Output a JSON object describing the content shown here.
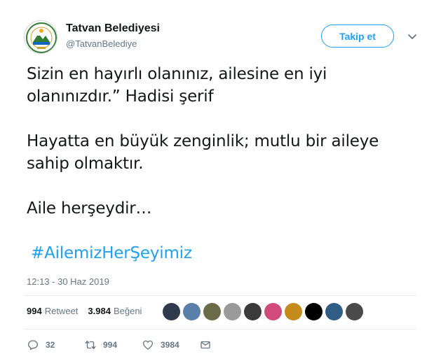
{
  "account": {
    "name": "Tatvan Belediyesi",
    "handle": "@TatvanBelediye",
    "avatar_icon": "municipality-logo-icon"
  },
  "follow_button": {
    "label": "Takip et"
  },
  "menu": {
    "icon": "chevron-down-icon"
  },
  "tweet": {
    "text": "Sizin en hayırlı olanınız, ailesine en iyi\nolanınızdır.” Hadisi şerif\n\nHayatta en büyük zenginlik; mutlu bir aileye\nsahip olmaktır.\n\nAile herşeydir…",
    "hashtag": "#AilemizHerŞeyimiz",
    "timestamp": "12:13 - 30 Haz 2019"
  },
  "stats": {
    "retweets_count": "994",
    "retweets_label": "Retweet",
    "likes_count": "3.984",
    "likes_label": "Beğeni"
  },
  "likers": [
    {
      "name": "liker-avatar-1",
      "color": "#2f3b4c"
    },
    {
      "name": "liker-avatar-2",
      "color": "#5a7fa8"
    },
    {
      "name": "liker-avatar-3",
      "color": "#6b6b4a"
    },
    {
      "name": "liker-avatar-4",
      "color": "#9a9a9a"
    },
    {
      "name": "liker-avatar-5",
      "color": "#3a3a3a"
    },
    {
      "name": "liker-avatar-6",
      "color": "#d04a7a"
    },
    {
      "name": "liker-avatar-7",
      "color": "#c48a1a"
    },
    {
      "name": "liker-avatar-8",
      "color": "#000000"
    },
    {
      "name": "liker-avatar-9",
      "color": "#2e5d86"
    },
    {
      "name": "liker-avatar-10",
      "color": "#4a4a4a"
    }
  ],
  "actions": {
    "replies": "32",
    "retweets": "994",
    "likes": "3984"
  },
  "colors": {
    "accent": "#1da1f2",
    "text": "#14171a",
    "muted": "#657786",
    "divider": "#e6ecf0"
  }
}
